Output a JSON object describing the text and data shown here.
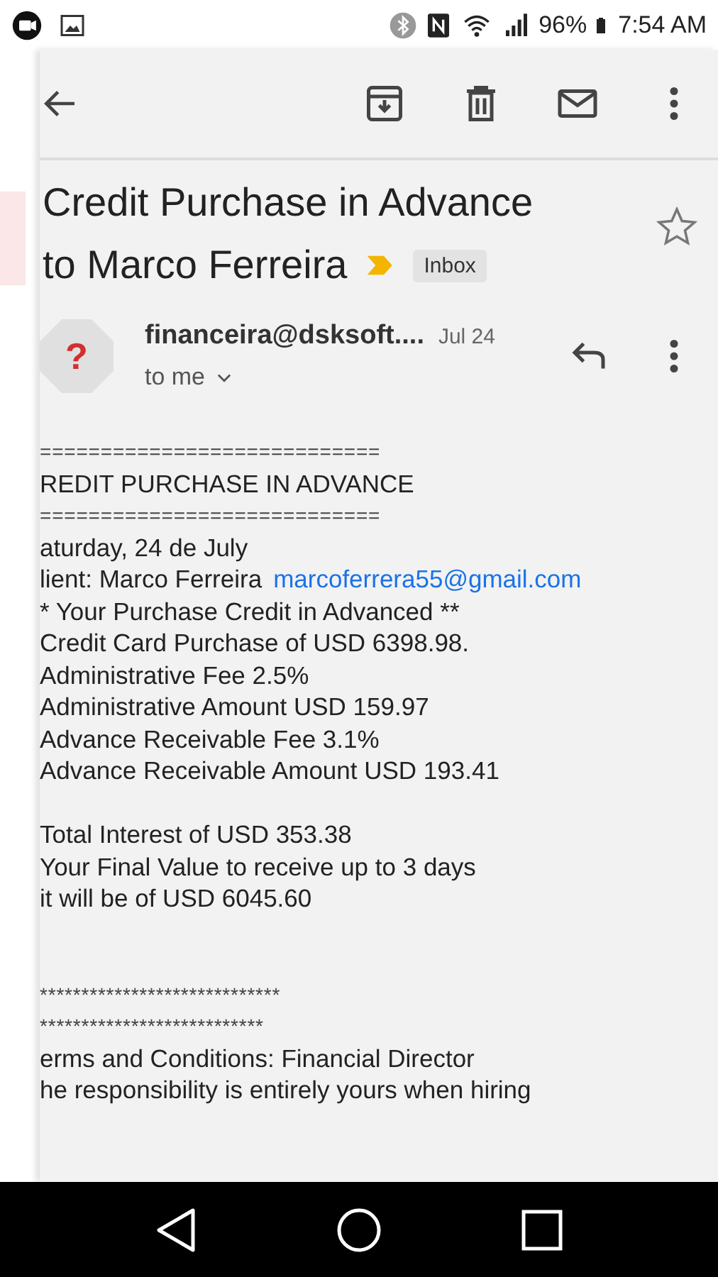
{
  "status_bar": {
    "battery": "96%",
    "time": "7:54 AM"
  },
  "subject": {
    "lines": [
      "Credit Purchase in Advance",
      "to Marco Ferreira"
    ],
    "label": "Inbox",
    "important": true,
    "starred": false
  },
  "message": {
    "sender": "financeira@dsksoft....",
    "date": "Jul 24",
    "recipient": "to me",
    "avatar": "?"
  },
  "body": [
    {
      "kind": "rule",
      "text": "============================"
    },
    {
      "kind": "text",
      "text": "REDIT PURCHASE IN ADVANCE"
    },
    {
      "kind": "rule",
      "text": "============================"
    },
    {
      "kind": "text",
      "text": "aturday, 24 de July"
    },
    {
      "kind": "client",
      "text": "lient: Marco Ferreira",
      "link": "marcoferrera55@gmail.com"
    },
    {
      "kind": "text",
      "text": "* Your Purchase Credit in Advanced **"
    },
    {
      "kind": "text",
      "text": "Credit Card Purchase of USD 6398.98."
    },
    {
      "kind": "text",
      "text": "Administrative Fee 2.5%"
    },
    {
      "kind": "text",
      "text": "Administrative Amount USD 159.97"
    },
    {
      "kind": "text",
      "text": "Advance Receivable Fee 3.1%"
    },
    {
      "kind": "text",
      "text": "Advance Receivable Amount USD 193.41"
    },
    {
      "kind": "gap"
    },
    {
      "kind": "text",
      "text": "Total Interest of USD 353.38"
    },
    {
      "kind": "text",
      "text": "Your Final Value to receive up to 3 days"
    },
    {
      "kind": "text",
      "text": "it will be of USD 6045.60"
    },
    {
      "kind": "gap"
    },
    {
      "kind": "gap"
    },
    {
      "kind": "rule",
      "text": "*****************************"
    },
    {
      "kind": "rule",
      "text": "***************************"
    },
    {
      "kind": "text",
      "text": "erms and Conditions: Financial Director"
    },
    {
      "kind": "text",
      "text": "he responsibility is entirely yours when hiring"
    }
  ]
}
